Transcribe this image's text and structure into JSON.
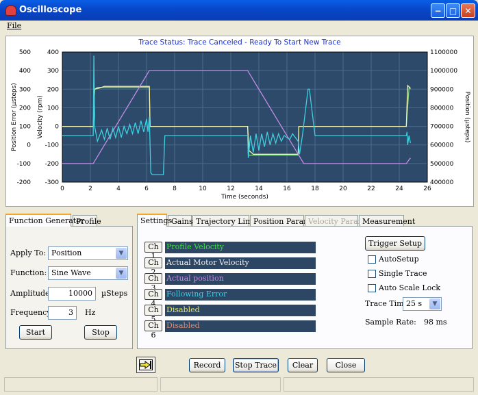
{
  "window": {
    "title": "Oscilloscope"
  },
  "menu": {
    "file": "File"
  },
  "trace_status": "Trace Status:  Trace Canceled - Ready To Start New Trace",
  "chart_data": {
    "type": "line",
    "xlabel": "Time (seconds)",
    "ylabel_left_outer": "Position Error (µsteps)",
    "ylabel_left_inner": "Velocity (rpm)",
    "ylabel_right": "Position (µsteps)",
    "x_ticks": [
      "0",
      "2",
      "4",
      "6",
      "8",
      "10",
      "12",
      "14",
      "16",
      "18",
      "20",
      "22",
      "24",
      "26"
    ],
    "y_left_outer_ticks": [
      "500",
      "400",
      "300",
      "200",
      "100",
      "0",
      "-100",
      "-200"
    ],
    "y_left_inner_ticks": [
      "400",
      "300",
      "200",
      "100",
      "0",
      "-100",
      "-200",
      "-300"
    ],
    "y_right_ticks": [
      "1100000",
      "1000000",
      "900000",
      "800000",
      "700000",
      "600000",
      "500000",
      "400000"
    ],
    "xlim": [
      0,
      26
    ],
    "ylim_velocity": [
      -300,
      400
    ],
    "ylim_position": [
      400000,
      1100000
    ],
    "grid": true,
    "background": "#2d4a6a",
    "series": [
      {
        "name": "Profile Velocity",
        "color": "#7fd87f",
        "axis": "velocity",
        "x": [
          0,
          2.2,
          2.3,
          2.5,
          6.2,
          6.25,
          13.2,
          13.25,
          16.8,
          16.85,
          24.5,
          24.7,
          24.8
        ],
        "y": [
          0,
          0,
          200,
          210,
          210,
          0,
          0,
          -155,
          -155,
          0,
          0,
          210,
          200
        ]
      },
      {
        "name": "Actual Motor Velocity",
        "color": "#f4f4b0",
        "axis": "velocity",
        "x": [
          0,
          2.2,
          2.3,
          2.6,
          3,
          6.2,
          6.25,
          13.2,
          13.3,
          13.6,
          16.8,
          16.85,
          24.5,
          24.6,
          24.8
        ],
        "y": [
          0,
          0,
          200,
          205,
          215,
          215,
          0,
          0,
          -130,
          -150,
          -150,
          0,
          0,
          220,
          205
        ]
      },
      {
        "name": "Actual position",
        "color": "#c58ee8",
        "axis": "position",
        "x": [
          0,
          2.2,
          6.2,
          13.2,
          17.2,
          24.5,
          24.8
        ],
        "y": [
          500000,
          500000,
          1000000,
          1000000,
          500000,
          500000,
          530000
        ]
      },
      {
        "name": "Following Error",
        "color": "#3fd0e0",
        "axis": "velocity",
        "x": [
          0,
          2.2,
          2.25,
          2.3,
          2.5,
          2.8,
          3,
          3.2,
          3.4,
          3.6,
          3.8,
          4,
          4.2,
          4.4,
          4.6,
          4.8,
          5,
          5.2,
          5.4,
          5.6,
          5.8,
          6,
          6.1,
          6.2,
          6.3,
          6.4,
          7.2,
          7.3,
          13.2,
          13.25,
          13.4,
          13.6,
          13.8,
          14,
          14.2,
          14.4,
          14.6,
          14.8,
          15,
          15.2,
          15.4,
          15.6,
          15.8,
          16,
          16.2,
          16.4,
          16.6,
          16.8,
          16.9,
          17,
          17.1,
          17.5,
          17.6,
          18,
          18.1,
          24.5,
          24.55,
          24.6,
          24.7,
          24.8
        ],
        "y": [
          -50,
          -50,
          380,
          0,
          -80,
          -20,
          -70,
          -10,
          -70,
          -10,
          -60,
          0,
          -60,
          0,
          -40,
          10,
          -40,
          20,
          -40,
          30,
          -30,
          40,
          -30,
          50,
          -250,
          -260,
          -260,
          -50,
          -50,
          -170,
          -50,
          -140,
          -40,
          -130,
          -40,
          -110,
          -30,
          -100,
          -40,
          -90,
          -40,
          -80,
          -50,
          -60,
          -70,
          -40,
          -60,
          -80,
          -150,
          -100,
          -50,
          200,
          200,
          -50,
          -50,
          -50,
          -30,
          -100,
          -50,
          -90
        ]
      }
    ]
  },
  "function_generator": {
    "tabs": [
      "Function Generator",
      "Profile"
    ],
    "apply_to_label": "Apply To:",
    "apply_to_value": "Position",
    "function_label": "Function:",
    "function_value": "Sine Wave",
    "amplitude_label": "Amplitude:",
    "amplitude_value": "10000",
    "amplitude_unit": "µSteps",
    "frequency_label": "Frequency:",
    "frequency_value": "3",
    "frequency_unit": "Hz",
    "start_label": "Start",
    "stop_label": "Stop"
  },
  "settings": {
    "tabs": [
      "Settings",
      "Gains",
      "Trajectory Limits",
      "Position Params",
      "Velocity Params",
      "Measurement"
    ],
    "channels": [
      {
        "label": "Ch 1",
        "value": "Profile Velocity",
        "color": "#3ce23c"
      },
      {
        "label": "Ch 2",
        "value": "Actual Motor Velocity",
        "color": "#f0f0f0"
      },
      {
        "label": "Ch 3",
        "value": "Actual position",
        "color": "#c58ee8"
      },
      {
        "label": "Ch 4",
        "value": "Following Error",
        "color": "#3fd0e0"
      },
      {
        "label": "Ch 5",
        "value": "Disabled",
        "color": "#e6e66a"
      },
      {
        "label": "Ch 6",
        "value": "Disabled",
        "color": "#e08a6a"
      }
    ],
    "trigger_setup": "Trigger Setup",
    "autosetup": "AutoSetup",
    "single_trace": "Single Trace",
    "auto_scale_lock": "Auto Scale Lock",
    "trace_time_label": "Trace Time:",
    "trace_time_value": "25 s",
    "sample_rate_label": "Sample Rate:",
    "sample_rate_value": "98 ms"
  },
  "bottom": {
    "record": "Record",
    "stop_trace": "Stop Trace",
    "clear": "Clear",
    "close": "Close"
  }
}
